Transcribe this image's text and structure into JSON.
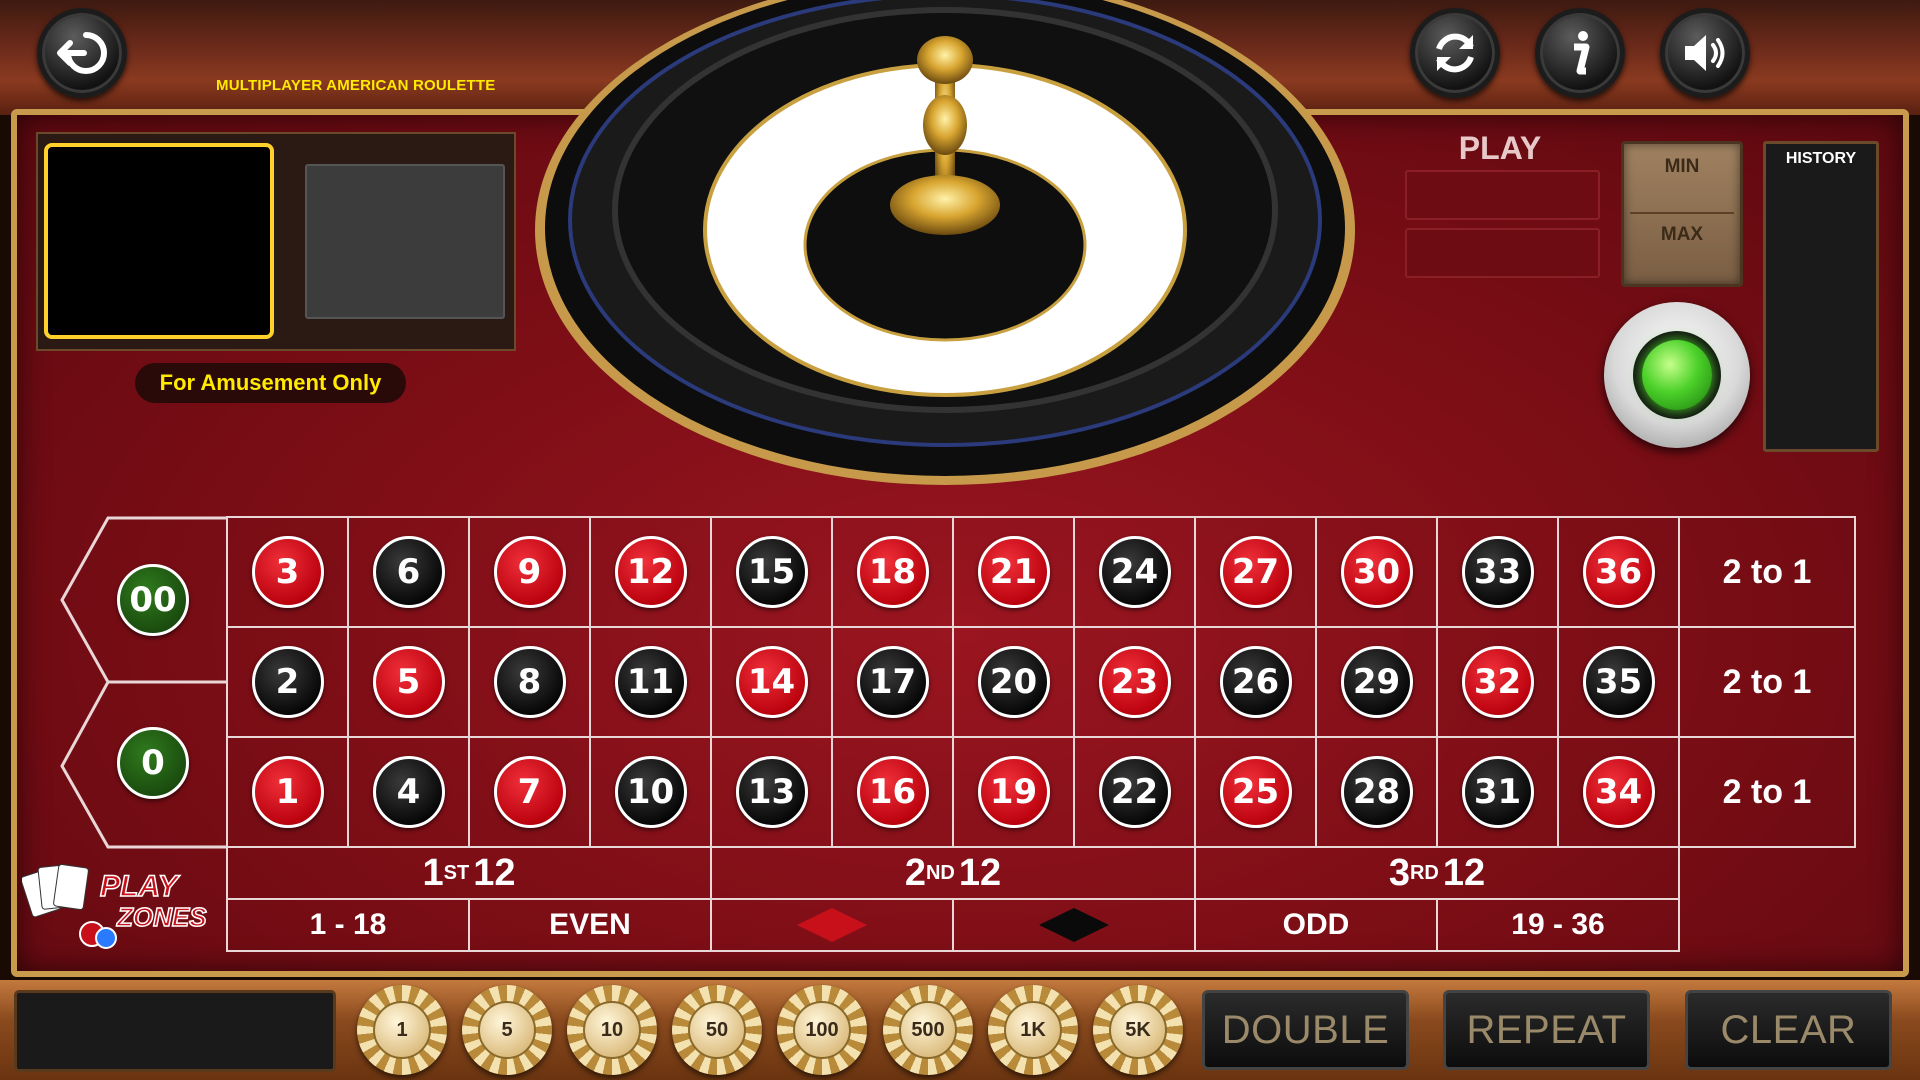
{
  "header": {
    "game_title": "MULTIPLAYER AMERICAN ROULETTE",
    "back_icon": "back-icon",
    "refresh_icon": "refresh-icon",
    "info_icon": "info-icon",
    "sound_icon": "speaker-icon"
  },
  "video": {
    "amusement_label": "For Amusement Only"
  },
  "play_panel": {
    "play_label": "PLAY",
    "min_label": "MIN",
    "max_label": "MAX",
    "history_label": "HISTORY"
  },
  "table": {
    "zeros": [
      "00",
      "0"
    ],
    "rows": [
      [
        {
          "n": "3",
          "c": "red"
        },
        {
          "n": "6",
          "c": "black"
        },
        {
          "n": "9",
          "c": "red"
        },
        {
          "n": "12",
          "c": "red"
        },
        {
          "n": "15",
          "c": "black"
        },
        {
          "n": "18",
          "c": "red"
        },
        {
          "n": "21",
          "c": "red"
        },
        {
          "n": "24",
          "c": "black"
        },
        {
          "n": "27",
          "c": "red"
        },
        {
          "n": "30",
          "c": "red"
        },
        {
          "n": "33",
          "c": "black"
        },
        {
          "n": "36",
          "c": "red"
        }
      ],
      [
        {
          "n": "2",
          "c": "black"
        },
        {
          "n": "5",
          "c": "red"
        },
        {
          "n": "8",
          "c": "black"
        },
        {
          "n": "11",
          "c": "black"
        },
        {
          "n": "14",
          "c": "red"
        },
        {
          "n": "17",
          "c": "black"
        },
        {
          "n": "20",
          "c": "black"
        },
        {
          "n": "23",
          "c": "red"
        },
        {
          "n": "26",
          "c": "black"
        },
        {
          "n": "29",
          "c": "black"
        },
        {
          "n": "32",
          "c": "red"
        },
        {
          "n": "35",
          "c": "black"
        }
      ],
      [
        {
          "n": "1",
          "c": "red"
        },
        {
          "n": "4",
          "c": "black"
        },
        {
          "n": "7",
          "c": "red"
        },
        {
          "n": "10",
          "c": "black"
        },
        {
          "n": "13",
          "c": "black"
        },
        {
          "n": "16",
          "c": "red"
        },
        {
          "n": "19",
          "c": "red"
        },
        {
          "n": "22",
          "c": "black"
        },
        {
          "n": "25",
          "c": "red"
        },
        {
          "n": "28",
          "c": "black"
        },
        {
          "n": "31",
          "c": "black"
        },
        {
          "n": "34",
          "c": "red"
        }
      ]
    ],
    "column_bets": [
      "2 to 1",
      "2 to 1",
      "2 to 1"
    ],
    "dozens": [
      {
        "num": "1",
        "sup": "ST",
        "label": "12"
      },
      {
        "num": "2",
        "sup": "ND",
        "label": "12"
      },
      {
        "num": "3",
        "sup": "RD",
        "label": "12"
      }
    ],
    "even_bets": [
      "1 - 18",
      "EVEN",
      "",
      "",
      "ODD",
      "19 - 36"
    ],
    "colors": {
      "red": "#c8101a",
      "black": "#0a0a0a",
      "green": "#1f5a12"
    }
  },
  "logo": {
    "text1": "PLAY",
    "text2": "ZONES"
  },
  "chips": [
    "1",
    "5",
    "10",
    "50",
    "100",
    "500",
    "1K",
    "5K"
  ],
  "actions": {
    "double": "DOUBLE",
    "repeat": "REPEAT",
    "clear": "CLEAR"
  }
}
